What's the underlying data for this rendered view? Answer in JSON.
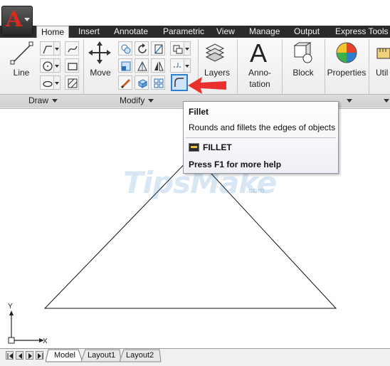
{
  "tabs": [
    {
      "label": "Home",
      "active": true
    },
    {
      "label": "Insert",
      "active": false
    },
    {
      "label": "Annotate",
      "active": false
    },
    {
      "label": "Parametric",
      "active": false
    },
    {
      "label": "View",
      "active": false
    },
    {
      "label": "Manage",
      "active": false
    },
    {
      "label": "Output",
      "active": false
    },
    {
      "label": "Express Tools",
      "active": false
    }
  ],
  "ribbon": {
    "line_label": "Line",
    "move_label": "Move",
    "layers_label": "Layers",
    "annotation_label_1": "Anno-",
    "annotation_label_2": "tation",
    "annotation_glyph": "A",
    "block_label": "Block",
    "properties_label": "Properties",
    "utilities_label": "Util",
    "draw_panel": "Draw",
    "modify_panel": "Modify"
  },
  "tooltip": {
    "title": "Fillet",
    "description": "Rounds and fillets the edges of objects",
    "command": "FILLET",
    "help": "Press F1 for more help"
  },
  "canvas": {
    "watermark": "TipsMake",
    "watermark_suffix": ".com",
    "ucs_y": "Y",
    "ucs_x": "X"
  },
  "layout_tabs": [
    "Model",
    "Layout1",
    "Layout2"
  ],
  "colors": {
    "tabbar": "#2b2b2b",
    "fillet_highlight": "#2f7fd0",
    "arrow": "#e8312f",
    "app_logo": "#d62b1e"
  }
}
